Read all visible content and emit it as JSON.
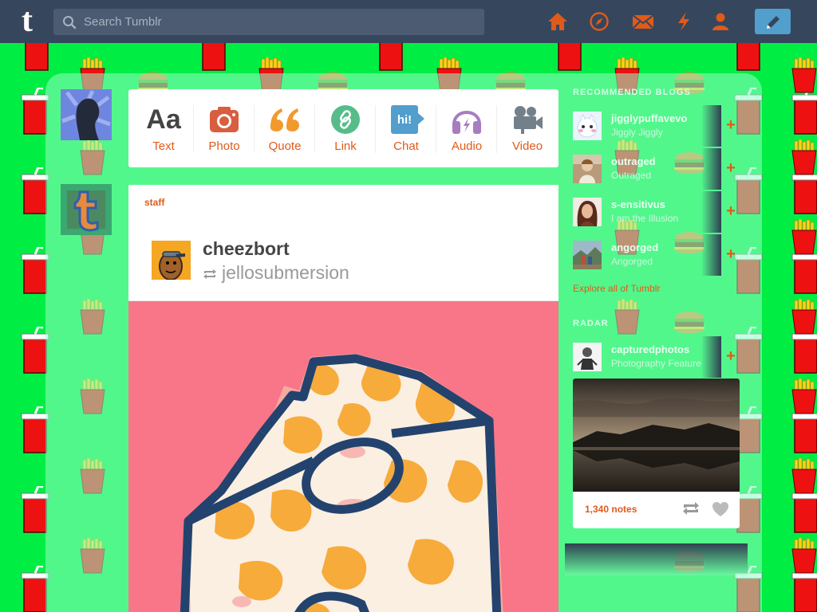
{
  "app": {
    "logo_letter": "t"
  },
  "search": {
    "placeholder": "Search Tumblr",
    "icon": "search-icon"
  },
  "nav": {
    "icons": [
      "home-icon",
      "explore-icon",
      "messages-icon",
      "activity-icon",
      "account-icon"
    ],
    "compose_icon": "pencil-icon"
  },
  "colors": {
    "topbar": "#36465d",
    "accent": "#e05a1a",
    "background": "#00ee44",
    "post_image": "#f87688",
    "compose": "#529ecc"
  },
  "post_types": [
    {
      "label": "Text",
      "glyph": "Aa",
      "color": "#444444",
      "icon": "text-icon"
    },
    {
      "label": "Photo",
      "glyph": "",
      "color": "#d95e40",
      "icon": "camera-icon"
    },
    {
      "label": "Quote",
      "glyph": "““",
      "color": "#f2992e",
      "icon": "quote-icon"
    },
    {
      "label": "Link",
      "glyph": "",
      "color": "#56bc8a",
      "icon": "link-icon"
    },
    {
      "label": "Chat",
      "glyph": "hi!",
      "color": "#529ecc",
      "icon": "chat-icon"
    },
    {
      "label": "Audio",
      "glyph": "",
      "color": "#a77dc2",
      "icon": "headphones-icon"
    },
    {
      "label": "Video",
      "glyph": "",
      "color": "#748089",
      "icon": "video-camera-icon"
    }
  ],
  "post": {
    "user": "staff",
    "name": "cheezbort",
    "reblogged_from": "jellosubmersion"
  },
  "sidebar": {
    "recommended_heading": "RECOMMENDED BLOGS",
    "blogs": [
      {
        "name": "jigglypuffavevo",
        "title": "Jiggly Jiggly"
      },
      {
        "name": "outraged",
        "title": "Outraged"
      },
      {
        "name": "s-ensitivus",
        "title": "I am the Illusion"
      },
      {
        "name": "angorged",
        "title": "Angorged"
      }
    ],
    "explore_link": "Explore all of Tumblr",
    "radar_heading": "RADAR",
    "radar": {
      "name": "capturedphotos",
      "title": "Photography Feature",
      "notes": "1,340 notes"
    }
  }
}
